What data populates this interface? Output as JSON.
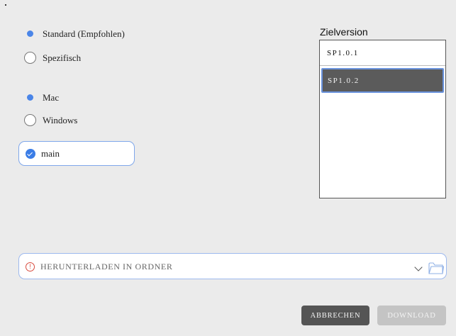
{
  "install_mode": {
    "options": [
      {
        "label": "Standard (Empfohlen)",
        "selected": true
      },
      {
        "label": "Spezifisch",
        "selected": false
      }
    ]
  },
  "platform": {
    "options": [
      {
        "label": "Mac",
        "selected": true
      },
      {
        "label": "Windows",
        "selected": false
      }
    ]
  },
  "branch": {
    "label": "main",
    "checked": true
  },
  "target_version": {
    "title": "Zielversion",
    "items": [
      "SP1.0.1",
      "SP1.0.2"
    ],
    "selected": "SP1.0.2"
  },
  "download_folder": {
    "placeholder": "HERUNTERLADEN IN ORDNER",
    "warning_icon": "warning-icon"
  },
  "actions": {
    "cancel": "ABBRECHEN",
    "download": "DOWNLOAD"
  },
  "colors": {
    "accent": "#4a85e8",
    "selected_bg": "#5b5b5b",
    "warning": "#d84b3e"
  }
}
